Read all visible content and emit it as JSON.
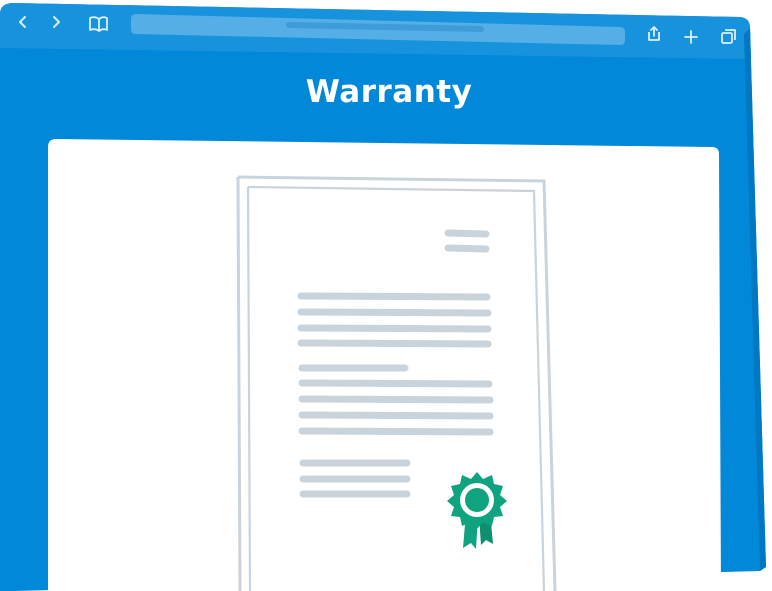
{
  "page": {
    "title": "Warranty"
  },
  "browser": {
    "toolbar_icons": [
      "back-chevron-icon",
      "forward-chevron-icon",
      "bookmarks-book-icon",
      "share-icon",
      "new-tab-plus-icon",
      "tabs-overview-icon"
    ],
    "address_bar": {
      "value": ""
    }
  },
  "document": {
    "type": "warranty-certificate-illustration",
    "badge_icon": "award-rosette-icon"
  },
  "colors": {
    "browser_blue": "#0288D9",
    "browser_blue_dark": "#0277C2",
    "address_bar": "#56AEE6",
    "card": "#FFFFFF",
    "paper_border": "#C9D3DB",
    "text_line": "#C9D3DB",
    "badge_green": "#10A37F"
  }
}
